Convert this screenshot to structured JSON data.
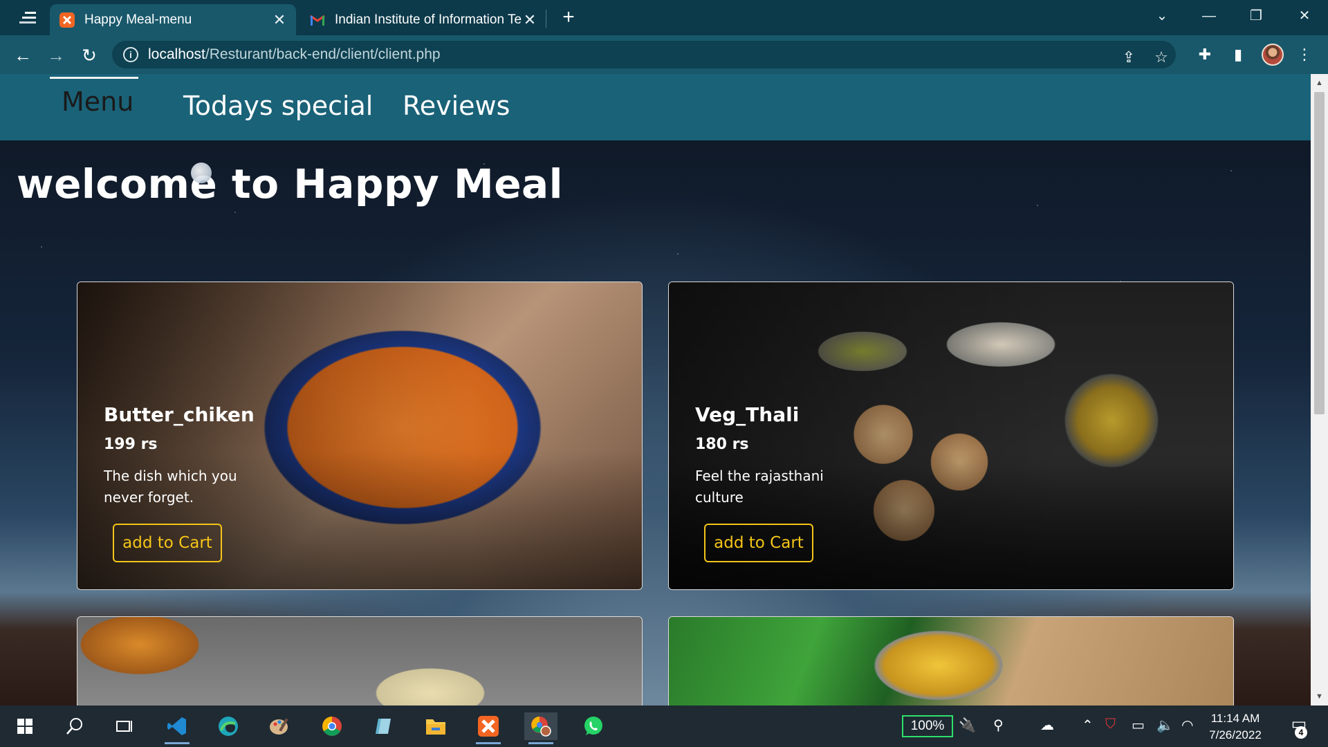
{
  "browser": {
    "tabs": [
      {
        "title": "Happy Meal-menu",
        "active": true,
        "favicon": "xampp-icon"
      },
      {
        "title": "Indian Institute of Information Te",
        "active": false,
        "favicon": "gmail-icon"
      }
    ],
    "new_tab_label": "+",
    "url_host": "localhost",
    "url_path": "/Resturant/back-end/client/client.php"
  },
  "site": {
    "nav": [
      "Menu",
      "Todays special",
      "Reviews"
    ],
    "active_nav": "Menu",
    "heading": "welcome to Happy Meal",
    "cards": [
      {
        "name": "Butter_chiken",
        "price": "199 rs",
        "description": "The dish which you never forget.",
        "button": "add to Cart"
      },
      {
        "name": "Veg_Thali",
        "price": "180 rs",
        "description": "Feel the rajasthani culture",
        "button": "add to Cart"
      }
    ],
    "button_color": "#f5c518",
    "nav_color": "#1a6278"
  },
  "taskbar": {
    "apps": [
      "start-icon",
      "search-icon",
      "task-view-icon",
      "vscode-icon",
      "edge-icon",
      "paint-icon",
      "chrome-icon",
      "notepad-icon",
      "file-explorer-icon",
      "xampp-icon",
      "chrome-profile-icon",
      "whatsapp-icon"
    ],
    "battery": "100%",
    "time": "11:14 AM",
    "date": "7/26/2022",
    "notifications": "4"
  }
}
